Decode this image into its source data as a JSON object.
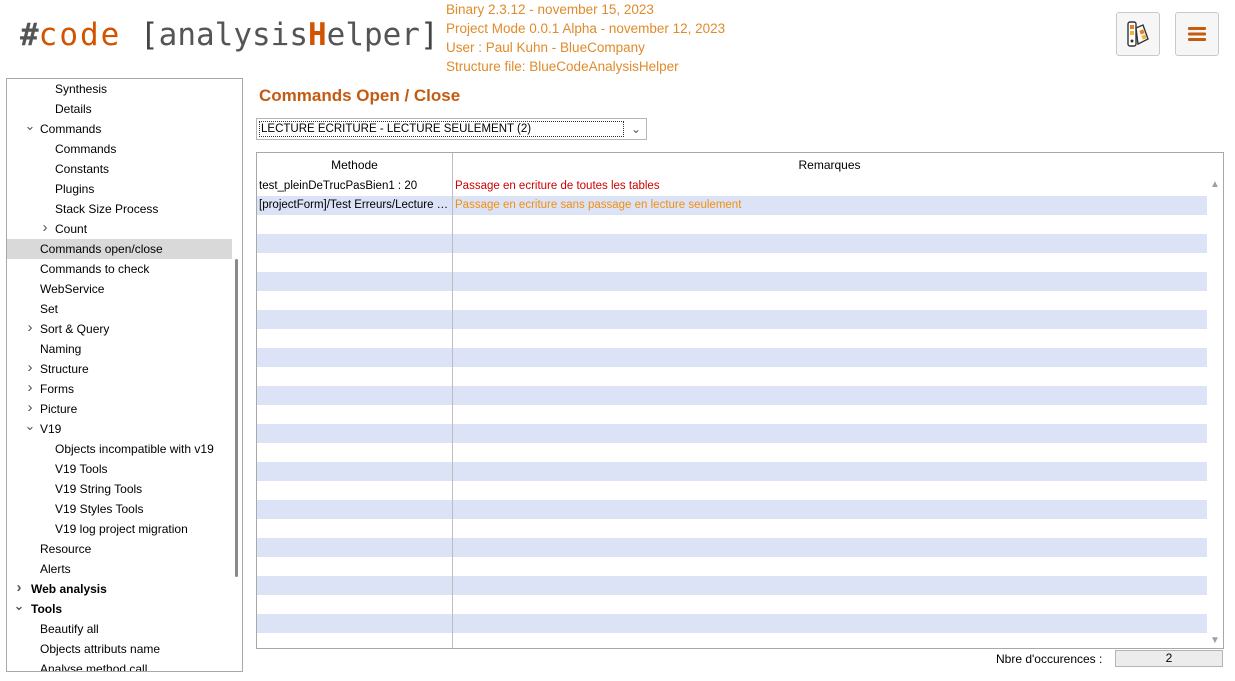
{
  "header": {
    "logo": {
      "hash": "#",
      "code": "code",
      "open": "[",
      "analysis": "analysis",
      "h": "H",
      "elper": "elper",
      "close": "]"
    },
    "info": [
      "Binary 2.3.12 - november 15, 2023",
      "Project Mode 0.0.1 Alpha - november 12, 2023",
      "User : Paul Kuhn - BlueCompany",
      "Structure file: BlueCodeAnalysisHelper"
    ]
  },
  "sidebar": {
    "items": [
      {
        "label": "Synthesis",
        "level": 2
      },
      {
        "label": "Details",
        "level": 2
      },
      {
        "label": "Commands",
        "level": 1,
        "chevron": "open"
      },
      {
        "label": "Commands",
        "level": 2
      },
      {
        "label": "Constants",
        "level": 2
      },
      {
        "label": "Plugins",
        "level": 2
      },
      {
        "label": "Stack Size Process",
        "level": 2
      },
      {
        "label": "Count",
        "level": 2,
        "chevron": "closed"
      },
      {
        "label": "Commands open/close",
        "level": 1,
        "selected": true
      },
      {
        "label": "Commands to check",
        "level": 1
      },
      {
        "label": "WebService",
        "level": 1
      },
      {
        "label": "Set",
        "level": 1
      },
      {
        "label": "Sort & Query",
        "level": 1,
        "chevron": "closed"
      },
      {
        "label": "Naming",
        "level": 1
      },
      {
        "label": "Structure",
        "level": 1,
        "chevron": "closed"
      },
      {
        "label": "Forms",
        "level": 1,
        "chevron": "closed"
      },
      {
        "label": "Picture",
        "level": 1,
        "chevron": "closed"
      },
      {
        "label": "V19",
        "level": 1,
        "chevron": "open"
      },
      {
        "label": "Objects incompatible with v19",
        "level": 2
      },
      {
        "label": "V19 Tools",
        "level": 2
      },
      {
        "label": "V19 String Tools",
        "level": 2
      },
      {
        "label": "V19 Styles Tools",
        "level": 2
      },
      {
        "label": "V19 log project migration",
        "level": 2
      },
      {
        "label": "Resource",
        "level": 1
      },
      {
        "label": "Alerts",
        "level": 1
      },
      {
        "label": "Web analysis",
        "level": 0,
        "chevron": "closed",
        "bold": true
      },
      {
        "label": "Tools",
        "level": 0,
        "chevron": "open",
        "bold": true
      },
      {
        "label": "Beautify all",
        "level": 1
      },
      {
        "label": "Objects attributs name",
        "level": 1
      },
      {
        "label": "Analyse method call",
        "level": 1
      }
    ]
  },
  "main": {
    "title": "Commands Open / Close",
    "dropdown": {
      "value": "LECTURE ECRITURE - LECTURE SEULEMENT  (2)"
    },
    "table": {
      "columns": [
        "Methode",
        "Remarques"
      ],
      "rows": [
        {
          "methode": "test_pleinDeTrucPasBien1 : 20",
          "remarque": "Passage en ecriture de toutes les tables",
          "color": "#cc0000"
        },
        {
          "methode": "[projectForm]/Test Erreurs/Lecture Ecriture",
          "remarque": "Passage en ecriture sans passage en lecture seulement",
          "color": "#f0900c"
        }
      ]
    },
    "occurrences": {
      "label": "Nbre d'occurences :",
      "value": "2"
    }
  }
}
